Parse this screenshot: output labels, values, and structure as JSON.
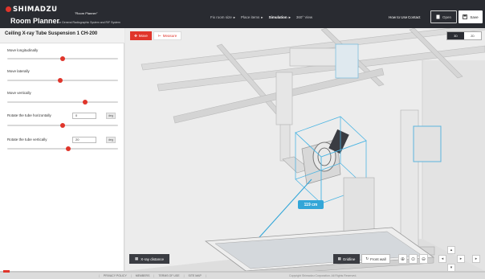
{
  "header": {
    "brand": "SHIMADZU",
    "app_name": "Room Planner",
    "product_quote": "\"Room Planner\"",
    "product_sub": "for General Radiographic System and R/F System",
    "steps": [
      "Fix room size",
      "Place items",
      "Simulation",
      "360° View"
    ],
    "active_step": 2,
    "how_to_use": "How to Use",
    "contact": "Contact",
    "open_label": "Open",
    "save_label": "Save"
  },
  "panel": {
    "title": "Ceiling X-ray Tube Suspension 1 CH-200",
    "controls": [
      {
        "label": "Move longitudinally",
        "position_fraction": 0.5
      },
      {
        "label": "Move laterally",
        "position_fraction": 0.48
      },
      {
        "label": "Move vertically",
        "position_fraction": 0.7
      },
      {
        "label": "Rotate the tube horizontally",
        "value": "0",
        "unit": "deg",
        "position_fraction": 0.5
      },
      {
        "label": "Rotate the tube vertically",
        "value": "20",
        "unit": "deg",
        "position_fraction": 0.55
      }
    ]
  },
  "scene": {
    "move_label": "Move",
    "measure_label": "Measure",
    "view_3d": "3D",
    "view_2d": "2D",
    "xray_distance_label": "X-ray distance",
    "distance_value": "119 cm",
    "gridline_label": "Gridline",
    "front_label": "Front wall"
  },
  "footer": {
    "links": [
      "PRIVACY POLICY",
      "MEMBERS",
      "TERMS OF USE",
      "SITE MAP"
    ],
    "copyright": "Copyright Shimadzu Corporation. All Rights Reserved."
  },
  "colors": {
    "accent_red": "#e0352b",
    "header_dark": "#292b31",
    "measure_blue": "#33a6d8"
  }
}
